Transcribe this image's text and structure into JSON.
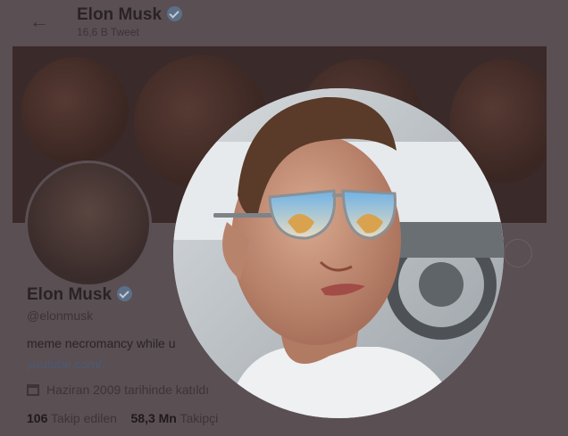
{
  "header": {
    "name": "Elon Musk",
    "tweet_count": "16,6 B Tweet"
  },
  "profile": {
    "name": "Elon Musk",
    "handle": "@elonmusk",
    "bio": "meme necromancy while u",
    "link": "youtube.com/..",
    "joined": "Haziran 2009 tarihinde katıldı",
    "following_count": "106",
    "following_label": "Takip edilen",
    "followers_count": "58,3 Mn",
    "followers_label": "Takipçi"
  },
  "photo_modal": {
    "subject": "profile photo enlarged"
  },
  "colors": {
    "overlay": "#5a4f53",
    "verified_badge": "#5c6f86"
  }
}
